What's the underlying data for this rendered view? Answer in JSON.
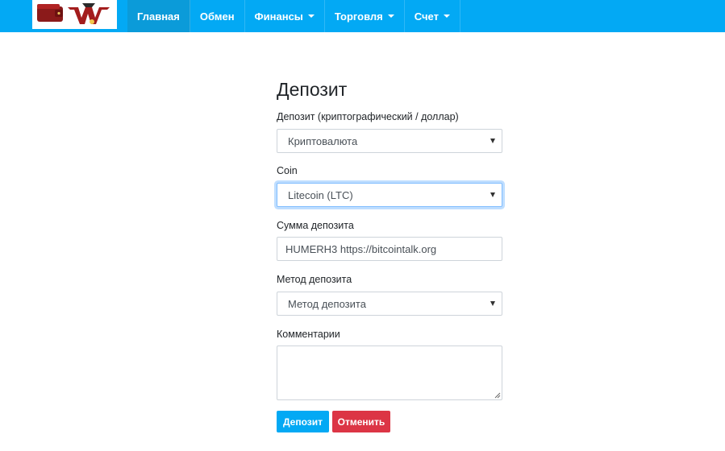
{
  "nav": {
    "items": [
      {
        "label": "Главная",
        "active": true
      },
      {
        "label": "Обмен"
      },
      {
        "label": "Финансы",
        "dropdown": true
      },
      {
        "label": "Торговля",
        "dropdown": true
      },
      {
        "label": "Счет",
        "dropdown": true
      }
    ]
  },
  "form": {
    "title": "Депозит",
    "deposit_type": {
      "label": "Депозит (криптографический / доллар)",
      "value": "Криптовалюта"
    },
    "coin": {
      "label": "Coin",
      "value": "Litecoin (LTC)"
    },
    "amount": {
      "label": "Сумма депозита",
      "value": "HUMERH3 https://bitcointalk.org"
    },
    "method": {
      "label": "Метод депозита",
      "value": "Метод депозита"
    },
    "comments": {
      "label": "Комментарии",
      "value": ""
    },
    "submit_label": "Депозит",
    "cancel_label": "Отменить"
  },
  "colors": {
    "navbar": "#03a9f4",
    "primary_button": "#03a9f4",
    "danger_button": "#dc3545"
  }
}
